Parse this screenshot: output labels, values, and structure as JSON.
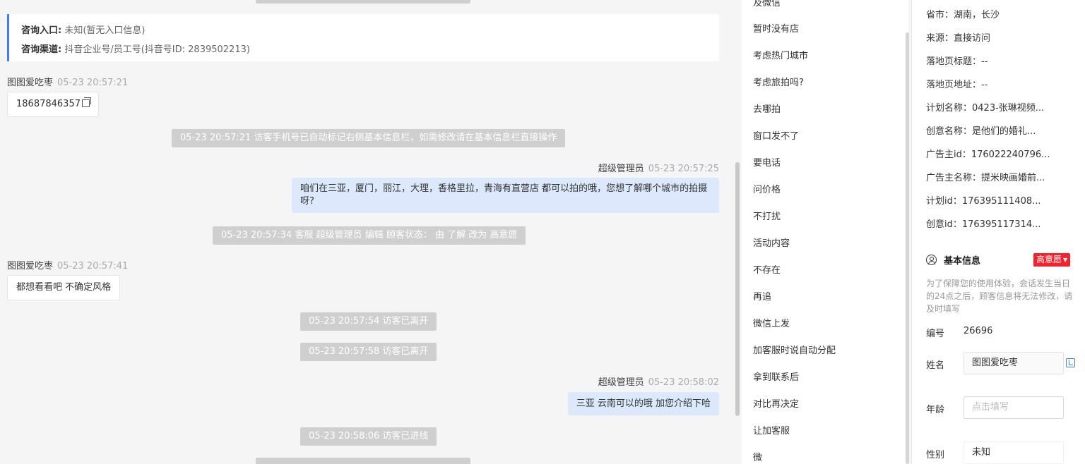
{
  "chat": {
    "info_card": {
      "entry_label": "咨询入口:",
      "entry_value": "未知(暂无入口信息)",
      "channel_label": "咨询渠道:",
      "channel_value": "抖音企业号/员工号(抖音号ID: 2839502213)"
    },
    "messages": [
      {
        "sender": "图图爱吃枣",
        "time": "05-23 20:57:21",
        "text": "18687846357"
      },
      {
        "system": "05-23 20:57:21 访客手机号已自动标记右侧基本信息栏，如需修改请在基本信息栏直接操作"
      },
      {
        "sender": "超级管理员",
        "time": "05-23 20:57:25",
        "text": "咱们在三亚，厦门，丽江，大理，香格里拉，青海有直营店 都可以拍的哦，您想了解哪个城市的拍摄呀?"
      },
      {
        "system": "05-23 20:57:34 客服 超级管理员 编辑 顾客状态： 由 了解 改为 高意愿"
      },
      {
        "sender": "图图爱吃枣",
        "time": "05-23 20:57:41",
        "text": "都想看看吧 不确定风格"
      },
      {
        "system": "05-23 20:57:54 访客已离开"
      },
      {
        "system": "05-23 20:57:58 访客已离开"
      },
      {
        "sender": "超级管理员",
        "time": "05-23 20:58:02",
        "text": "三亚 云南可以的哦 加您介绍下哈"
      },
      {
        "system": "05-23 20:58:06 访客已进线"
      }
    ]
  },
  "quick_replies": [
    "及微信",
    "暂时没有店",
    "考虑热门城市",
    "考虑旅拍吗?",
    "去哪拍",
    "窗口发不了",
    "要电话",
    "问价格",
    "不打扰",
    "活动内容",
    "不存在",
    "再追",
    "微信上发",
    "加客服时说自动分配",
    "拿到联系后",
    "对比再决定",
    "让加客服",
    "微"
  ],
  "visitor_info": [
    "省市：湖南，长沙",
    "来源：直接访问",
    "落地页标题：--",
    "落地页地址：--",
    "计划名称：0423-张琳视频...",
    "创意名称：是他们的婚礼...",
    "广告主id：176022240796...",
    "广告主名称：提米映画婚前...",
    "计划id：176395111408...",
    "创意id：176395117314..."
  ],
  "basic_info": {
    "title": "基本信息",
    "status_badge": "高意愿",
    "note": "为了保障您的使用体验，会话发生当日的24点之后，顾客信息将无法修改，请及时填写",
    "id_label": "编号",
    "id_value": "26696",
    "name_label": "姓名",
    "name_value": "图图爱吃枣",
    "age_label": "年龄",
    "age_placeholder": "点击填写",
    "gender_label": "性别",
    "gender_value": "未知"
  },
  "colors": {
    "accent": "#3d7eff",
    "bubble_self": "#dce9fd",
    "system_pill": "#cfcfcf",
    "badge_red": "#f5222d"
  }
}
